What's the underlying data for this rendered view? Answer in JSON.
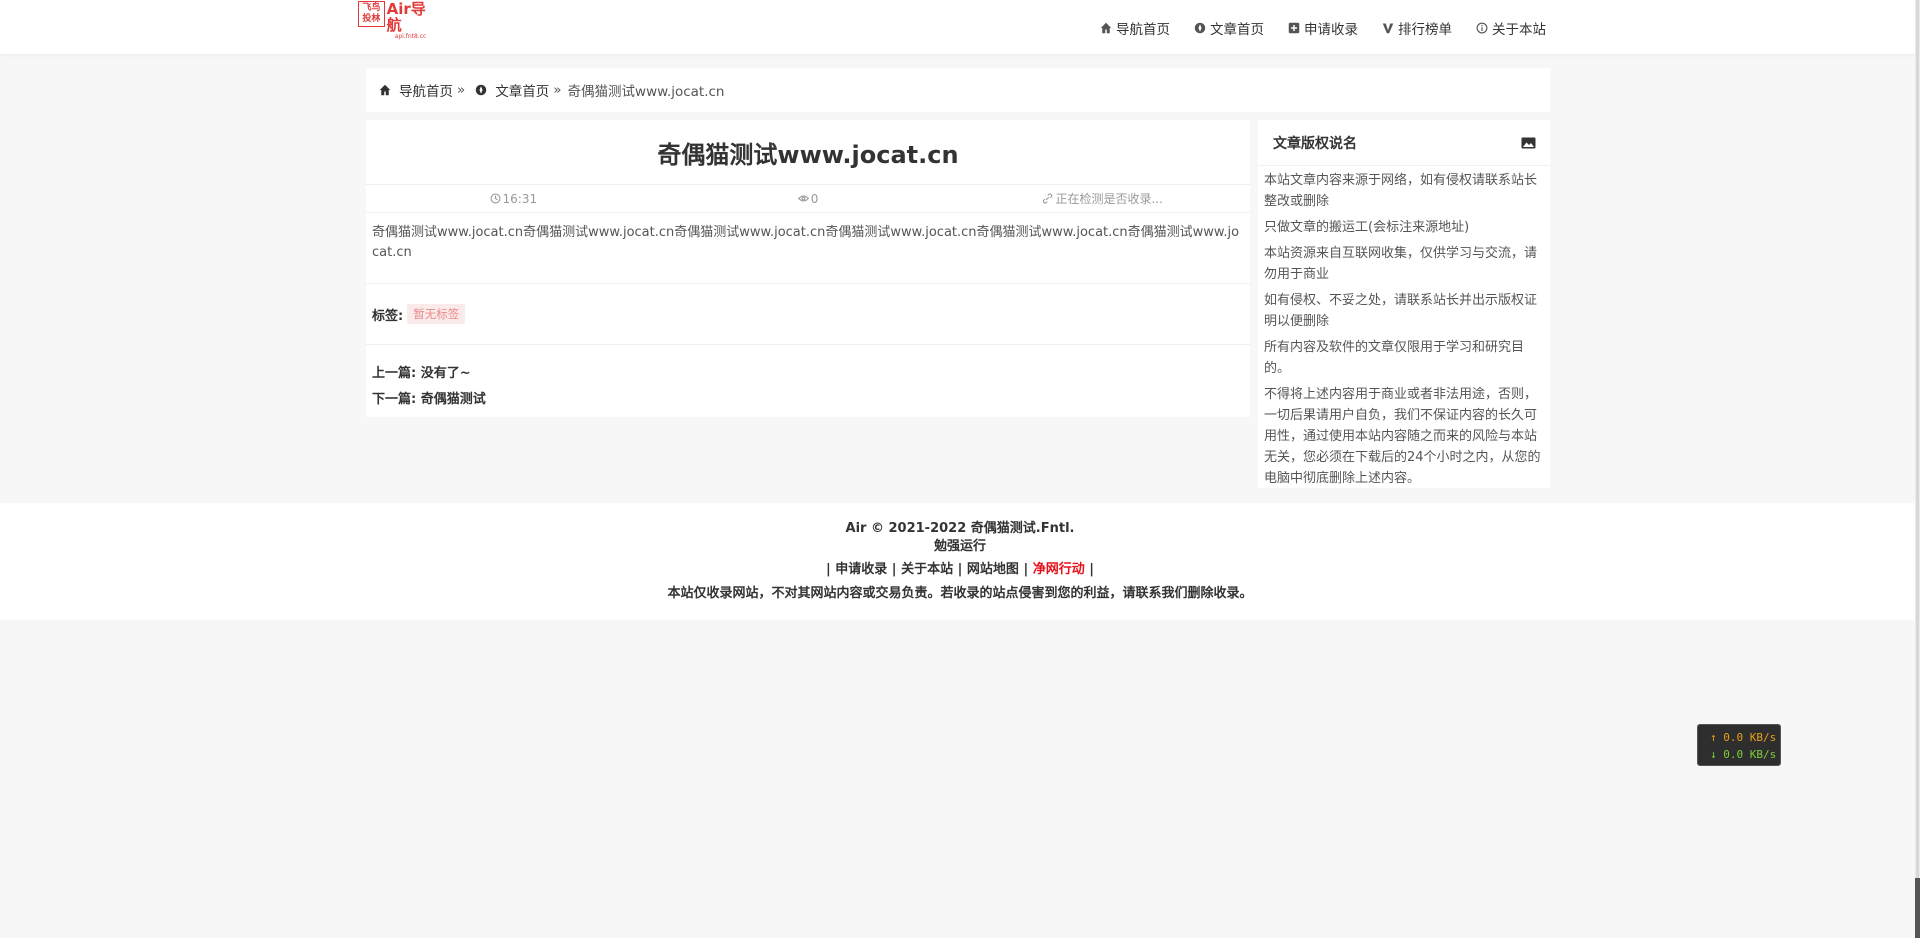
{
  "header": {
    "logo_box": "飞鸟 投林",
    "logo_title": "Air导航",
    "logo_sub": "api.fnt8.cc",
    "nav": [
      {
        "label": "导航首页",
        "icon": "home-icon"
      },
      {
        "label": "文章首页",
        "icon": "compass-icon"
      },
      {
        "label": "申请收录",
        "icon": "plus-square-icon"
      },
      {
        "label": "排行榜单",
        "icon": "v-icon"
      },
      {
        "label": "关于本站",
        "icon": "info-icon"
      }
    ]
  },
  "breadcrumb": {
    "home": "导航首页",
    "sep1": "»",
    "articles": "文章首页",
    "sep2": "»",
    "current": "奇偶猫测试www.jocat.cn"
  },
  "article": {
    "title": "奇偶猫测试www.jocat.cn",
    "time": "16:31",
    "views": "0",
    "index_status": "正在检测是否收录...",
    "body": "奇偶猫测试www.jocat.cn奇偶猫测试www.jocat.cn奇偶猫测试www.jocat.cn奇偶猫测试www.jocat.cn奇偶猫测试www.jocat.cn奇偶猫测试www.jocat.cn",
    "tags_label": "标签:",
    "tag_empty": "暂无标签",
    "prev_label": "上一篇:",
    "prev_value": "没有了~",
    "next_label": "下一篇:",
    "next_value": "奇偶猫测试"
  },
  "sidebar": {
    "title": "文章版权说名",
    "items": [
      "本站文章内容来源于网络，如有侵权请联系站长整改或删除",
      "只做文章的搬运工(会标注来源地址)",
      "本站资源来自互联网收集，仅供学习与交流，请勿用于商业",
      "如有侵权、不妥之处，请联系站长并出示版权证明以便删除",
      "所有内容及软件的文章仅限用于学习和研究目的。",
      "不得将上述内容用于商业或者非法用途，否则，一切后果请用户自负，我们不保证内容的长久可用性，通过使用本站内容随之而来的风险与本站无关，您必须在下载后的24个小时之内，从您的电脑中彻底删除上述内容。"
    ]
  },
  "footer": {
    "copyright": "Air © 2021-2022 奇偶猫测试.Fntl.",
    "running": "勉强运行",
    "links": [
      "申请收录",
      "关于本站",
      "网站地图",
      "净网行动"
    ],
    "disclaimer": "本站仅收录网站，不对其网站内容或交易负责。若收录的站点侵害到您的利益，请联系我们删除收录。"
  },
  "netspeed": {
    "up": "↑ 0.0 KB/s",
    "down": "↓ 0.0 KB/s"
  },
  "colors": {
    "accent_red": "#e8101a",
    "logo_red": "#e03a3a",
    "tag_bg": "#fbeaea"
  }
}
